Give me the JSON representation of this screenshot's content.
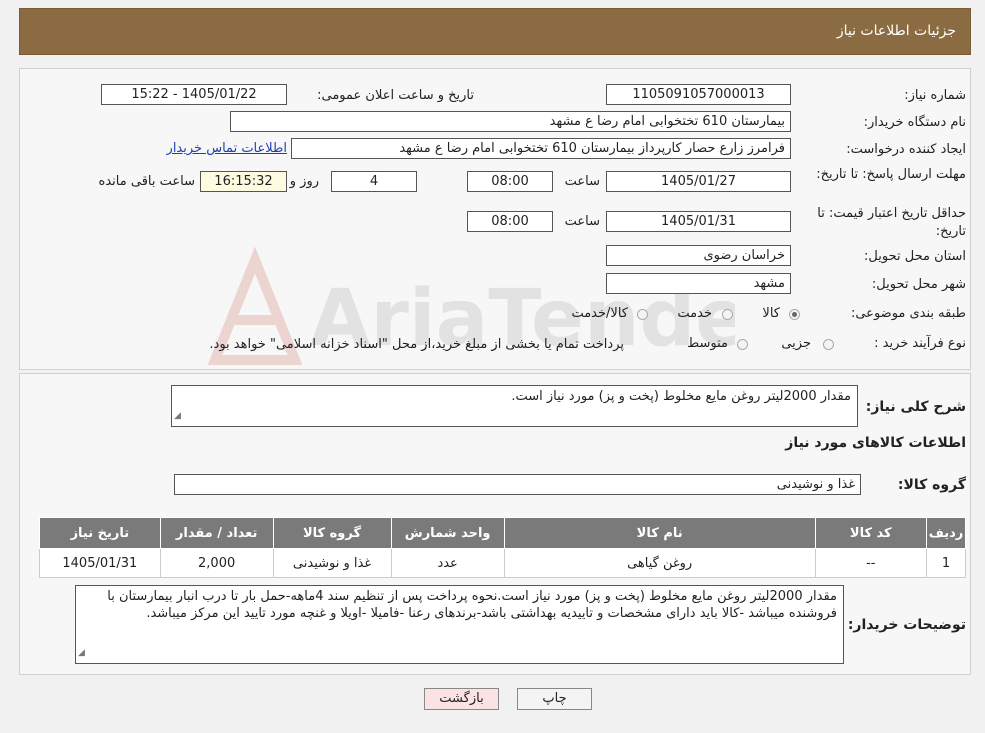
{
  "header": {
    "title": "جزئیات اطلاعات نیاز"
  },
  "watermark": {
    "text": "AriaTender.net"
  },
  "form": {
    "need_number_label": "شماره نیاز:",
    "need_number": "1105091057000013",
    "announce_label": "تاریخ و ساعت اعلان عمومی:",
    "announce_value": "1405/01/22 - 15:22",
    "buyer_org_label": "نام دستگاه خریدار:",
    "buyer_org": "بیمارستان 610 تختخوابی امام رضا ع  مشهد",
    "creator_label": "ایجاد کننده درخواست:",
    "creator": "فرامرز زارع حصار کارپرداز بیمارستان 610 تختخوابی امام رضا ع  مشهد",
    "contact_link": "اطلاعات تماس خریدار",
    "deadline_label": "مهلت ارسال پاسخ: تا تاریخ:",
    "deadline_date": "1405/01/27",
    "time_label": "ساعت",
    "deadline_time": "08:00",
    "days_value": "4",
    "days_label": "روز و",
    "remaining_time": "16:15:32",
    "remaining_label": "ساعت باقی مانده",
    "validity_label": "حداقل تاریخ اعتبار قیمت: تا تاریخ:",
    "validity_date": "1405/01/31",
    "validity_time": "08:00",
    "province_label": "استان محل تحویل:",
    "province": "خراسان رضوی",
    "city_label": "شهر محل تحویل:",
    "city": "مشهد",
    "category_label": "طبقه بندی موضوعی:",
    "category_options": [
      "کالا",
      "خدمت",
      "کالا/خدمت"
    ],
    "category_selected": "کالا",
    "process_label": "نوع فرآیند خرید :",
    "process_options": [
      "جزیی",
      "متوسط"
    ],
    "process_note": "پرداخت تمام یا بخشی از مبلغ خرید،از محل \"اسناد خزانه اسلامی\" خواهد بود."
  },
  "summary": {
    "label": "شرح کلی نیاز:",
    "text": "مقدار 2000لیتر روغن مایع مخلوط (پخت و پز) مورد نیاز است."
  },
  "goods": {
    "title": "اطلاعات کالاهای مورد نیاز",
    "group_label": "گروه کالا:",
    "group_value": "غذا و نوشیدنی",
    "columns": [
      "ردیف",
      "کد کالا",
      "نام کالا",
      "واحد شمارش",
      "گروه کالا",
      "تعداد / مقدار",
      "تاریخ نیاز"
    ],
    "rows": [
      [
        "1",
        "--",
        "روغن گیاهی",
        "عدد",
        "غذا و نوشیدنی",
        "2,000",
        "1405/01/31"
      ]
    ]
  },
  "buyer_notes": {
    "label": "توضیحات خریدار:",
    "text": "مقدار 2000لیتر روغن مایع مخلوط (پخت و پز) مورد نیاز است.نحوه پرداخت پس از تنظیم سند 4ماهه-حمل بار تا درب انبار بیمارستان با فروشنده میباشد -کالا باید دارای مشخصات و تاییدیه بهداشتی باشد-برندهای رعنا -فامیلا -اویلا و غنچه مورد تایید این مرکز میباشد."
  },
  "buttons": {
    "print": "چاپ",
    "back": "بازگشت"
  },
  "colors": {
    "header_bg": "#8b6b42",
    "table_header_bg": "#7a7a7a",
    "link": "#1f3fb5",
    "back_button_bg": "#fbe3e3"
  }
}
